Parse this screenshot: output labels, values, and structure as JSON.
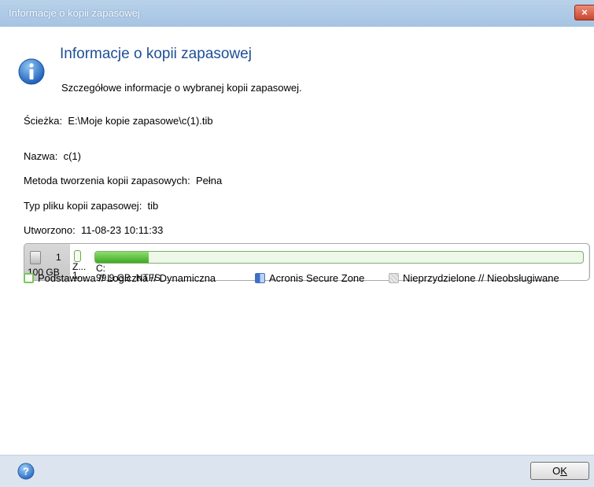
{
  "window": {
    "title": "Informacje o kopii zapasowej",
    "close_glyph": "×"
  },
  "header": {
    "title": "Informacje o kopii zapasowej",
    "subtitle": "Szczegółowe informacje o wybranej kopii zapasowej.",
    "icon": "info-icon"
  },
  "details": {
    "path_label": "Ścieżka:",
    "path_value": "E:\\Moje kopie zapasowe\\c(1).tib",
    "name_label": "Nazwa:",
    "name_value": "c(1)",
    "method_label": "Metoda tworzenia kopii zapasowych:",
    "method_value": "Pełna",
    "type_label": "Typ pliku kopii zapasowej:",
    "type_value": "tib",
    "created_label": "Utworzono:",
    "created_value": "11-08-23 10:11:33"
  },
  "disk": {
    "number": "1",
    "size": "100 GB",
    "small_partition": {
      "line1": "Z...",
      "line2": "1..."
    },
    "main_partition": {
      "letter": "C:",
      "size_fs": "99,9 GB  NTFS",
      "used_fraction": 0.11
    }
  },
  "legend": {
    "basic": "Podstawowa // Logiczna // Dynamiczna",
    "secure_zone": "Acronis Secure Zone",
    "unallocated": "Nieprzydzielone // Nieobsługiwane"
  },
  "footer": {
    "ok_prefix": "O",
    "ok_accel": "K",
    "help_icon": "help-icon"
  },
  "colors": {
    "title_blue": "#1e4f96",
    "partition_green": "#3fa924",
    "titlebar": "#a6c3e2"
  }
}
